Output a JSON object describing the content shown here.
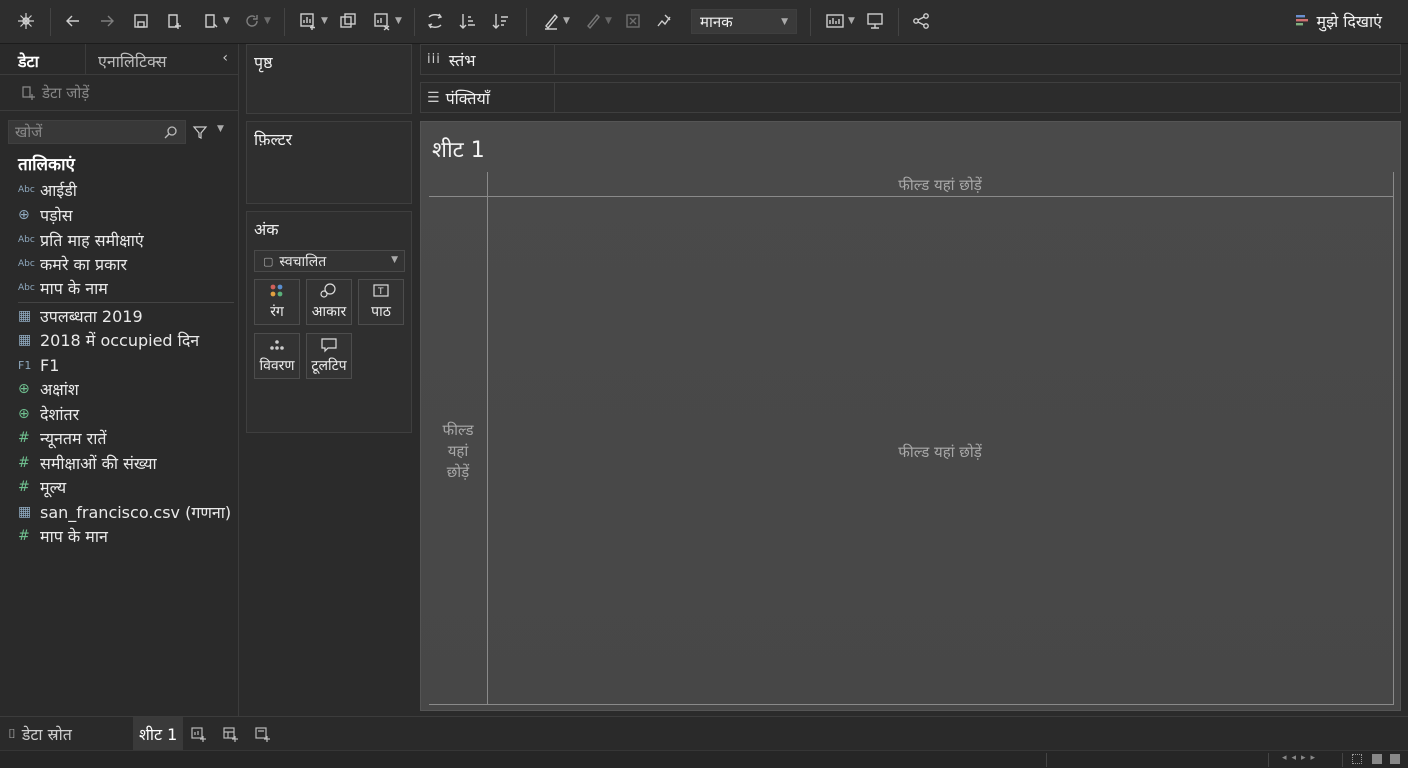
{
  "toolbar": {
    "standard_label": "मानक",
    "show_me_label": "मुझे दिखाएं"
  },
  "left_pane": {
    "tab_data": "डेटा",
    "tab_analytics": "एनालिटिक्स",
    "connection_placeholder": "डेटा जोड़ें",
    "search_placeholder": "खोजें",
    "tables_header": "तालिकाएं",
    "fields": [
      {
        "icon": "Abc",
        "label": "आईडी"
      },
      {
        "icon": "globe",
        "label": "पड़ोस"
      },
      {
        "icon": "Abc",
        "label": "प्रति माह समीक्षाएं"
      },
      {
        "icon": "Abc",
        "label": "कमरे का प्रकार"
      },
      {
        "icon": "Abc",
        "label": "माप के नाम"
      },
      {
        "icon": "table",
        "label": "उपलब्धता 2019"
      },
      {
        "icon": "table",
        "label": "2018 में occupied दिन"
      },
      {
        "icon": "F1",
        "label": "F1"
      },
      {
        "icon": "globe",
        "label": "अक्षांश"
      },
      {
        "icon": "globe",
        "label": "देशांतर"
      },
      {
        "icon": "#",
        "label": "न्यूनतम रातें"
      },
      {
        "icon": "#",
        "label": "समीक्षाओं की संख्या"
      },
      {
        "icon": "#",
        "label": "मूल्य"
      },
      {
        "icon": "table",
        "label": "san_francisco.csv (गणना)"
      },
      {
        "icon": "#",
        "label": "माप के मान"
      }
    ]
  },
  "cards": {
    "pages": "पृष्ठ",
    "filters": "फ़िल्टर",
    "marks": "अंक",
    "mark_type": "स्वचालित",
    "buttons": {
      "color": "रंग",
      "size": "आकार",
      "text": "पाठ",
      "detail": "विवरण",
      "tooltip": "टूलटिप"
    }
  },
  "shelves": {
    "columns": "स्तंभ",
    "rows": "पंक्तियाँ"
  },
  "view": {
    "sheet_title": "शीट 1",
    "drop_top": "फील्ड यहां छोड़ें",
    "drop_left_1": "फील्ड",
    "drop_left_2": "यहां",
    "drop_left_3": "छोड़ें",
    "drop_center": "फील्ड यहां छोड़ें"
  },
  "bottom": {
    "data_source": "डेटा स्रोत",
    "sheet1": "शीट 1"
  },
  "colors": {
    "background": "#2b2b2b",
    "view_bg": "#4a4a4a",
    "accent_green": "#6fbf8f",
    "accent_blue": "#8fa9bf"
  }
}
